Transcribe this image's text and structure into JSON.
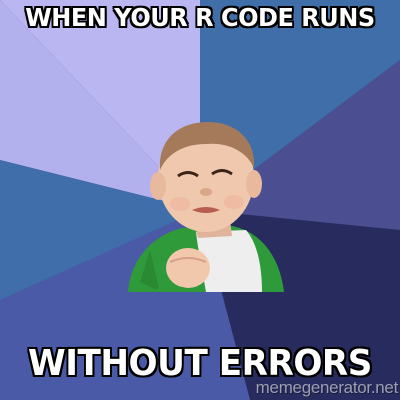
{
  "meme": {
    "top_text": "WHEN YOUR R CODE RUNS",
    "bottom_text": "WITHOUT ERRORS",
    "watermark": "memegenerator.net"
  },
  "colors": {
    "ray_light": "#b9b6f2",
    "ray_blue": "#3f6ea8",
    "ray_purple": "#4b4f92",
    "ray_dark": "#2b3568",
    "text": "#ffffff",
    "text_outline": "#000000"
  },
  "image": {
    "subject": "success-kid"
  }
}
